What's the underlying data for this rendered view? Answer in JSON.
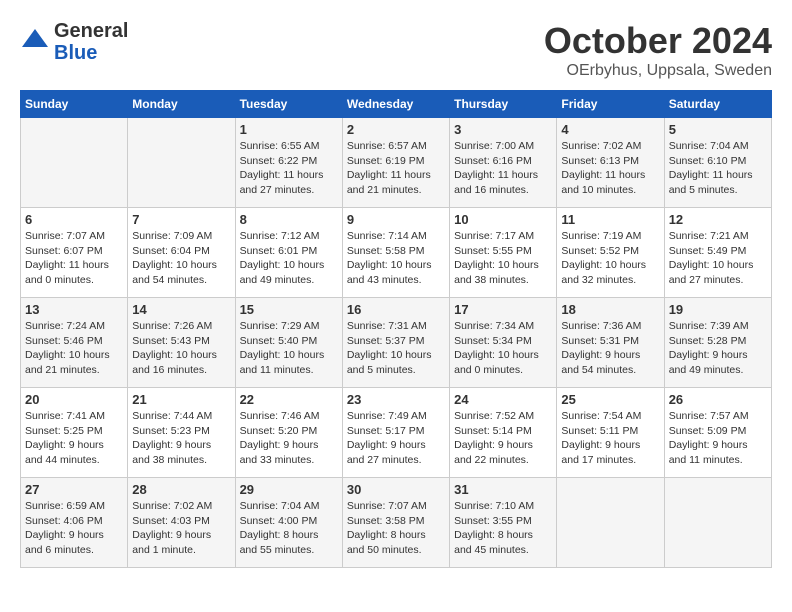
{
  "header": {
    "logo_general": "General",
    "logo_blue": "Blue",
    "title": "October 2024",
    "subtitle": "OErbyhus, Uppsala, Sweden"
  },
  "calendar": {
    "days_of_week": [
      "Sunday",
      "Monday",
      "Tuesday",
      "Wednesday",
      "Thursday",
      "Friday",
      "Saturday"
    ],
    "weeks": [
      [
        {
          "day": "",
          "info": ""
        },
        {
          "day": "",
          "info": ""
        },
        {
          "day": "1",
          "info": "Sunrise: 6:55 AM\nSunset: 6:22 PM\nDaylight: 11 hours and 27 minutes."
        },
        {
          "day": "2",
          "info": "Sunrise: 6:57 AM\nSunset: 6:19 PM\nDaylight: 11 hours and 21 minutes."
        },
        {
          "day": "3",
          "info": "Sunrise: 7:00 AM\nSunset: 6:16 PM\nDaylight: 11 hours and 16 minutes."
        },
        {
          "day": "4",
          "info": "Sunrise: 7:02 AM\nSunset: 6:13 PM\nDaylight: 11 hours and 10 minutes."
        },
        {
          "day": "5",
          "info": "Sunrise: 7:04 AM\nSunset: 6:10 PM\nDaylight: 11 hours and 5 minutes."
        }
      ],
      [
        {
          "day": "6",
          "info": "Sunrise: 7:07 AM\nSunset: 6:07 PM\nDaylight: 11 hours and 0 minutes."
        },
        {
          "day": "7",
          "info": "Sunrise: 7:09 AM\nSunset: 6:04 PM\nDaylight: 10 hours and 54 minutes."
        },
        {
          "day": "8",
          "info": "Sunrise: 7:12 AM\nSunset: 6:01 PM\nDaylight: 10 hours and 49 minutes."
        },
        {
          "day": "9",
          "info": "Sunrise: 7:14 AM\nSunset: 5:58 PM\nDaylight: 10 hours and 43 minutes."
        },
        {
          "day": "10",
          "info": "Sunrise: 7:17 AM\nSunset: 5:55 PM\nDaylight: 10 hours and 38 minutes."
        },
        {
          "day": "11",
          "info": "Sunrise: 7:19 AM\nSunset: 5:52 PM\nDaylight: 10 hours and 32 minutes."
        },
        {
          "day": "12",
          "info": "Sunrise: 7:21 AM\nSunset: 5:49 PM\nDaylight: 10 hours and 27 minutes."
        }
      ],
      [
        {
          "day": "13",
          "info": "Sunrise: 7:24 AM\nSunset: 5:46 PM\nDaylight: 10 hours and 21 minutes."
        },
        {
          "day": "14",
          "info": "Sunrise: 7:26 AM\nSunset: 5:43 PM\nDaylight: 10 hours and 16 minutes."
        },
        {
          "day": "15",
          "info": "Sunrise: 7:29 AM\nSunset: 5:40 PM\nDaylight: 10 hours and 11 minutes."
        },
        {
          "day": "16",
          "info": "Sunrise: 7:31 AM\nSunset: 5:37 PM\nDaylight: 10 hours and 5 minutes."
        },
        {
          "day": "17",
          "info": "Sunrise: 7:34 AM\nSunset: 5:34 PM\nDaylight: 10 hours and 0 minutes."
        },
        {
          "day": "18",
          "info": "Sunrise: 7:36 AM\nSunset: 5:31 PM\nDaylight: 9 hours and 54 minutes."
        },
        {
          "day": "19",
          "info": "Sunrise: 7:39 AM\nSunset: 5:28 PM\nDaylight: 9 hours and 49 minutes."
        }
      ],
      [
        {
          "day": "20",
          "info": "Sunrise: 7:41 AM\nSunset: 5:25 PM\nDaylight: 9 hours and 44 minutes."
        },
        {
          "day": "21",
          "info": "Sunrise: 7:44 AM\nSunset: 5:23 PM\nDaylight: 9 hours and 38 minutes."
        },
        {
          "day": "22",
          "info": "Sunrise: 7:46 AM\nSunset: 5:20 PM\nDaylight: 9 hours and 33 minutes."
        },
        {
          "day": "23",
          "info": "Sunrise: 7:49 AM\nSunset: 5:17 PM\nDaylight: 9 hours and 27 minutes."
        },
        {
          "day": "24",
          "info": "Sunrise: 7:52 AM\nSunset: 5:14 PM\nDaylight: 9 hours and 22 minutes."
        },
        {
          "day": "25",
          "info": "Sunrise: 7:54 AM\nSunset: 5:11 PM\nDaylight: 9 hours and 17 minutes."
        },
        {
          "day": "26",
          "info": "Sunrise: 7:57 AM\nSunset: 5:09 PM\nDaylight: 9 hours and 11 minutes."
        }
      ],
      [
        {
          "day": "27",
          "info": "Sunrise: 6:59 AM\nSunset: 4:06 PM\nDaylight: 9 hours and 6 minutes."
        },
        {
          "day": "28",
          "info": "Sunrise: 7:02 AM\nSunset: 4:03 PM\nDaylight: 9 hours and 1 minute."
        },
        {
          "day": "29",
          "info": "Sunrise: 7:04 AM\nSunset: 4:00 PM\nDaylight: 8 hours and 55 minutes."
        },
        {
          "day": "30",
          "info": "Sunrise: 7:07 AM\nSunset: 3:58 PM\nDaylight: 8 hours and 50 minutes."
        },
        {
          "day": "31",
          "info": "Sunrise: 7:10 AM\nSunset: 3:55 PM\nDaylight: 8 hours and 45 minutes."
        },
        {
          "day": "",
          "info": ""
        },
        {
          "day": "",
          "info": ""
        }
      ]
    ]
  }
}
